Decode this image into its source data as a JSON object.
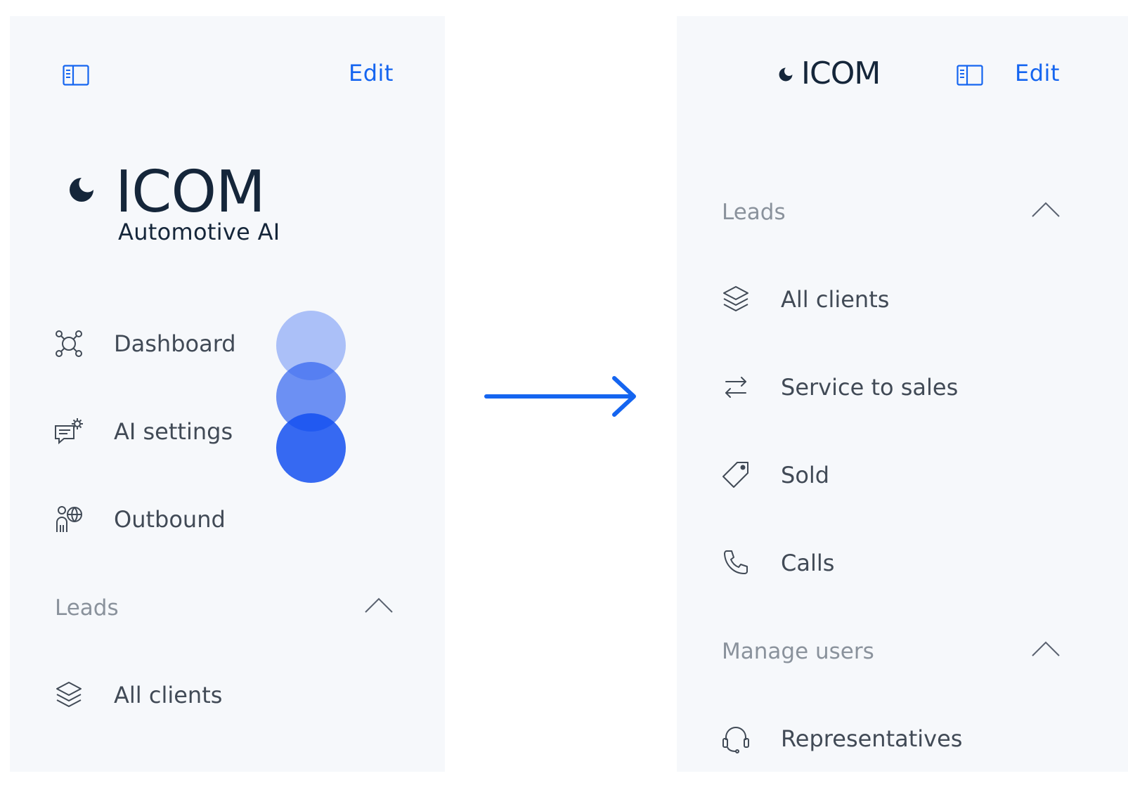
{
  "left_panel": {
    "edit_label": "Edit",
    "logo": {
      "wordmark": "ICOM",
      "subtitle": "Automotive AI"
    },
    "nav_items": [
      {
        "label": "Dashboard",
        "icon": "network-nodes-icon"
      },
      {
        "label": "AI settings",
        "icon": "chat-settings-icon"
      },
      {
        "label": "Outbound",
        "icon": "person-globe-icon"
      }
    ],
    "section": {
      "label": "Leads",
      "icon": "chevron-up-icon"
    },
    "section_items": [
      {
        "label": "All clients",
        "icon": "layers-icon"
      }
    ]
  },
  "right_panel": {
    "logo": {
      "wordmark": "ICOM"
    },
    "edit_label": "Edit",
    "sections": [
      {
        "label": "Leads",
        "icon": "chevron-up-icon",
        "items": [
          {
            "label": "All clients",
            "icon": "layers-icon"
          },
          {
            "label": "Service to sales",
            "icon": "swap-arrows-icon"
          },
          {
            "label": "Sold",
            "icon": "tag-icon"
          },
          {
            "label": "Calls",
            "icon": "phone-icon"
          }
        ]
      },
      {
        "label": "Manage users",
        "icon": "chevron-up-icon",
        "items": [
          {
            "label": "Representatives",
            "icon": "headset-icon"
          }
        ]
      }
    ]
  },
  "colors": {
    "panel_bg": "#f6f8fb",
    "accent": "#1565f0",
    "text": "#414a56",
    "muted": "#8a929c",
    "logo": "#15263a"
  }
}
